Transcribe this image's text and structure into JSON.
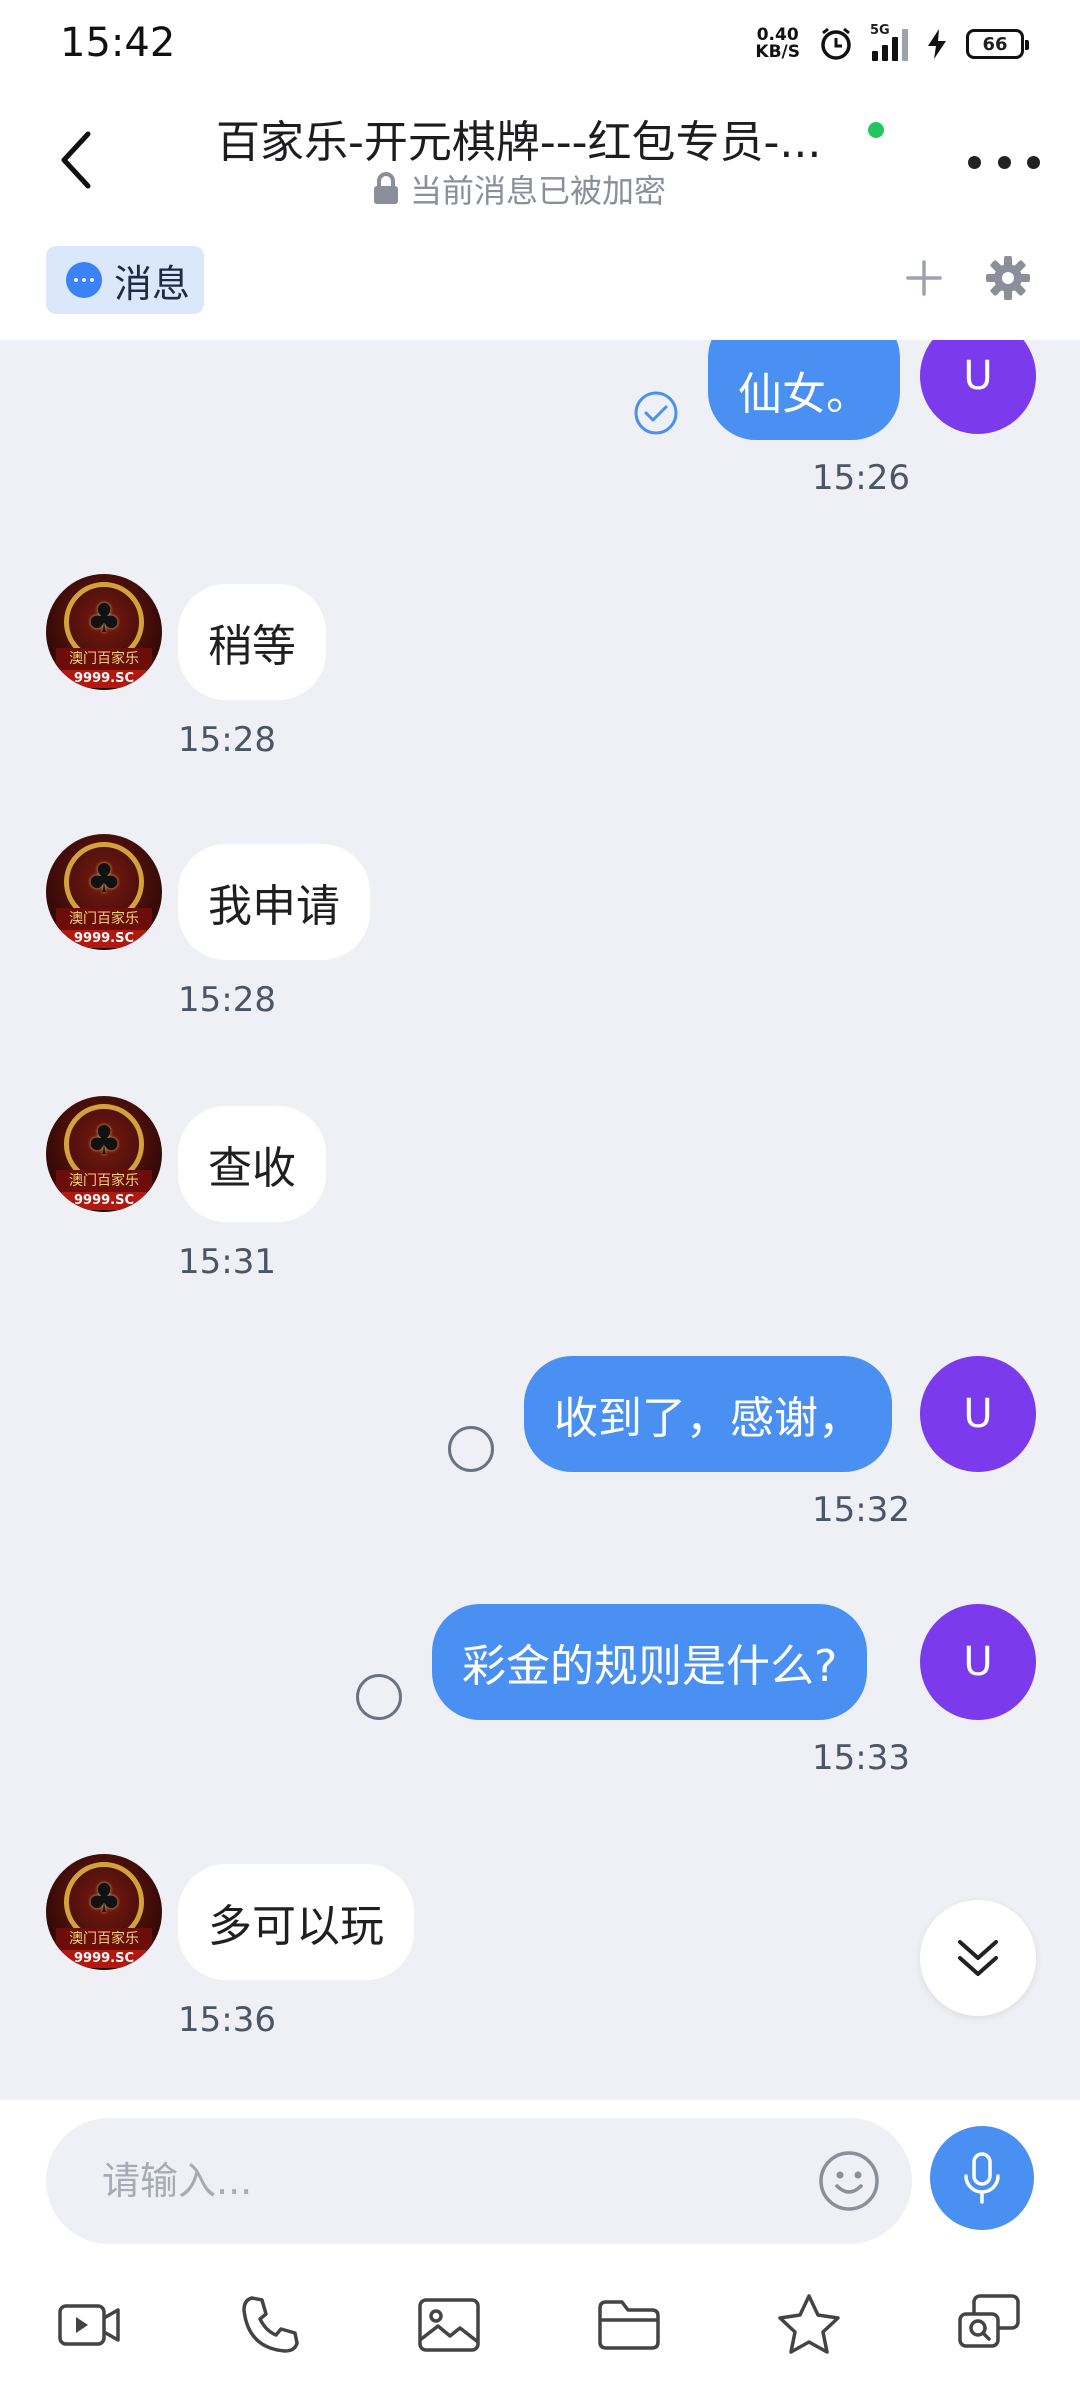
{
  "status_bar": {
    "time": "15:42",
    "net_speed_value": "0.40",
    "net_speed_unit": "KB/S",
    "signal_label": "5G",
    "battery": "66"
  },
  "header": {
    "title": "百家乐-开元棋牌---红包专员-...",
    "subtitle": "当前消息已被加密",
    "online_color": "#22c55e"
  },
  "tabs": {
    "messages_label": "消息"
  },
  "messages": [
    {
      "side": "out",
      "text": "仙女。",
      "time": "15:26",
      "status": "read"
    },
    {
      "side": "in",
      "text": "稍等",
      "time": "15:28"
    },
    {
      "side": "in",
      "text": "我申请",
      "time": "15:28"
    },
    {
      "side": "in",
      "text": "查收",
      "time": "15:31"
    },
    {
      "side": "out",
      "text": "收到了，感谢，",
      "time": "15:32",
      "status": "sent"
    },
    {
      "side": "out",
      "text": "彩金的规则是什么?",
      "time": "15:33",
      "status": "sent"
    },
    {
      "side": "in",
      "text": "多可以玩",
      "time": "15:36"
    }
  ],
  "avatars": {
    "user_initial": "U",
    "user_color": "#7c3aed",
    "bot_label_top": "澳门百家乐",
    "bot_label_bottom": "9999.SC"
  },
  "input": {
    "placeholder": "请输入..."
  },
  "toolbar_icons": [
    "video-icon",
    "phone-icon",
    "image-icon",
    "folder-icon",
    "star-icon",
    "search-chat-icon"
  ],
  "colors": {
    "accent": "#4a90f2",
    "chat_bg": "#eef0f5"
  }
}
